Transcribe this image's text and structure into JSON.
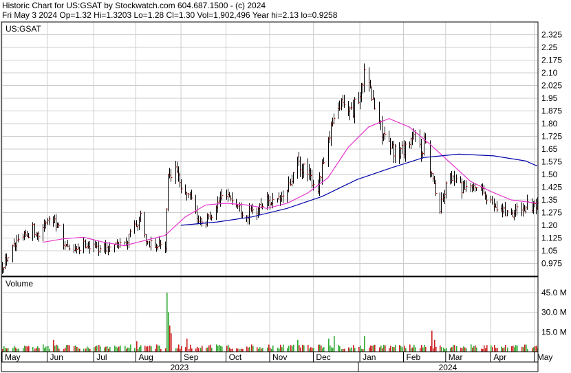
{
  "header": {
    "line1": "Historic Chart for US:GSAT by Stockwatch.com 604.687.1500 - (c) 2024",
    "line2": "Fri May  3 2024   Op=1.32   Hi=1.3203   Lo=1.28   Cl=1.30   Vol=1,902,496   Year hi=2.13   lo=0.9258"
  },
  "colors": {
    "bg": "#ffffff",
    "grid": "#cccccc",
    "frame": "#000000",
    "ma_short": "#e633cc",
    "ma_long": "#0000aa",
    "vol_up": "#33aa33",
    "vol_down": "#cc2222",
    "bar": "#000000",
    "close_tick": "#cc0000"
  },
  "chart_data": [
    {
      "type": "ohlc",
      "title": "US:GSAT",
      "ylim": [
        0.9,
        2.4
      ],
      "y_ticks": [
        0.975,
        1.05,
        1.125,
        1.2,
        1.275,
        1.35,
        1.425,
        1.5,
        1.575,
        1.65,
        1.725,
        1.8,
        1.875,
        1.95,
        2.025,
        2.1,
        2.175,
        2.25,
        2.325
      ],
      "y_tick_labels": [
        "0.975",
        "1.05",
        "1.125",
        "1.20",
        "1.275",
        "1.35",
        "1.425",
        "1.50",
        "1.575",
        "1.65",
        "1.725",
        "1.80",
        "1.875",
        "1.95",
        "2.025",
        "2.10",
        "2.175",
        "2.25",
        "2.325"
      ],
      "grid": true,
      "anchors": [
        [
          "2023-05-01",
          0.96
        ],
        [
          "2023-05-08",
          1.06
        ],
        [
          "2023-05-15",
          1.12
        ],
        [
          "2023-05-22",
          1.18
        ],
        [
          "2023-05-26",
          1.14
        ],
        [
          "2023-06-02",
          1.26
        ],
        [
          "2023-06-06",
          1.24
        ],
        [
          "2023-06-13",
          1.08
        ],
        [
          "2023-06-20",
          1.04
        ],
        [
          "2023-06-27",
          1.09
        ],
        [
          "2023-07-05",
          1.07
        ],
        [
          "2023-07-12",
          1.06
        ],
        [
          "2023-07-19",
          1.08
        ],
        [
          "2023-07-26",
          1.11
        ],
        [
          "2023-08-01",
          1.22
        ],
        [
          "2023-08-04",
          1.25
        ],
        [
          "2023-08-09",
          1.1
        ],
        [
          "2023-08-16",
          1.08
        ],
        [
          "2023-08-21",
          1.07
        ],
        [
          "2023-08-23",
          1.47
        ],
        [
          "2023-08-29",
          1.52
        ],
        [
          "2023-09-01",
          1.44
        ],
        [
          "2023-09-06",
          1.38
        ],
        [
          "2023-09-12",
          1.25
        ],
        [
          "2023-09-18",
          1.22
        ],
        [
          "2023-09-25",
          1.32
        ],
        [
          "2023-10-02",
          1.4
        ],
        [
          "2023-10-09",
          1.32
        ],
        [
          "2023-10-16",
          1.26
        ],
        [
          "2023-10-23",
          1.29
        ],
        [
          "2023-10-30",
          1.35
        ],
        [
          "2023-11-06",
          1.33
        ],
        [
          "2023-11-13",
          1.4
        ],
        [
          "2023-11-20",
          1.57
        ],
        [
          "2023-11-27",
          1.5
        ],
        [
          "2023-12-04",
          1.42
        ],
        [
          "2023-12-11",
          1.67
        ],
        [
          "2023-12-15",
          1.85
        ],
        [
          "2023-12-20",
          1.94
        ],
        [
          "2023-12-28",
          1.88
        ],
        [
          "2024-01-03",
          2.0
        ],
        [
          "2024-01-05",
          2.09
        ],
        [
          "2024-01-10",
          1.96
        ],
        [
          "2024-01-16",
          1.78
        ],
        [
          "2024-01-22",
          1.66
        ],
        [
          "2024-01-29",
          1.63
        ],
        [
          "2024-02-05",
          1.7
        ],
        [
          "2024-02-09",
          1.72
        ],
        [
          "2024-02-13",
          1.64
        ],
        [
          "2024-02-16",
          1.7
        ],
        [
          "2024-02-21",
          1.45
        ],
        [
          "2024-02-26",
          1.3
        ],
        [
          "2024-03-01",
          1.43
        ],
        [
          "2024-03-05",
          1.48
        ],
        [
          "2024-03-12",
          1.42
        ],
        [
          "2024-03-18",
          1.4
        ],
        [
          "2024-03-22",
          1.44
        ],
        [
          "2024-03-28",
          1.36
        ],
        [
          "2024-04-05",
          1.32
        ],
        [
          "2024-04-12",
          1.27
        ],
        [
          "2024-04-18",
          1.28
        ],
        [
          "2024-04-25",
          1.31
        ],
        [
          "2024-05-03",
          1.3
        ]
      ],
      "ma_short": [
        [
          "2023-05-29",
          1.1
        ],
        [
          "2023-06-12",
          1.12
        ],
        [
          "2023-06-26",
          1.13
        ],
        [
          "2023-07-10",
          1.1
        ],
        [
          "2023-07-24",
          1.08
        ],
        [
          "2023-08-07",
          1.11
        ],
        [
          "2023-08-21",
          1.14
        ],
        [
          "2023-09-04",
          1.25
        ],
        [
          "2023-09-18",
          1.32
        ],
        [
          "2023-10-02",
          1.33
        ],
        [
          "2023-10-16",
          1.32
        ],
        [
          "2023-10-30",
          1.3
        ],
        [
          "2023-11-13",
          1.33
        ],
        [
          "2023-11-27",
          1.39
        ],
        [
          "2023-12-11",
          1.48
        ],
        [
          "2023-12-25",
          1.66
        ],
        [
          "2024-01-08",
          1.78
        ],
        [
          "2024-01-22",
          1.83
        ],
        [
          "2024-02-05",
          1.78
        ],
        [
          "2024-02-19",
          1.68
        ],
        [
          "2024-03-04",
          1.57
        ],
        [
          "2024-03-18",
          1.46
        ],
        [
          "2024-04-01",
          1.4
        ],
        [
          "2024-04-15",
          1.35
        ],
        [
          "2024-05-03",
          1.33
        ]
      ],
      "ma_long": [
        [
          "2023-09-01",
          1.2
        ],
        [
          "2023-09-26",
          1.22
        ],
        [
          "2023-10-20",
          1.25
        ],
        [
          "2023-11-13",
          1.3
        ],
        [
          "2023-12-07",
          1.37
        ],
        [
          "2023-12-31",
          1.47
        ],
        [
          "2024-01-24",
          1.54
        ],
        [
          "2024-02-15",
          1.6
        ],
        [
          "2024-03-10",
          1.62
        ],
        [
          "2024-04-03",
          1.61
        ],
        [
          "2024-04-25",
          1.58
        ],
        [
          "2024-05-03",
          1.55
        ]
      ]
    },
    {
      "type": "bar",
      "title": "Volume",
      "ylim": [
        0,
        57
      ],
      "y_ticks": [
        15,
        30,
        45
      ],
      "y_tick_labels": [
        "15.0 M",
        "30.0 M",
        "45.0 M"
      ],
      "base_volume": 4,
      "spikes": [
        [
          "2023-06-05",
          9
        ],
        [
          "2023-08-01",
          8
        ],
        [
          "2023-08-22",
          45
        ],
        [
          "2023-08-23",
          30
        ],
        [
          "2023-08-24",
          20
        ],
        [
          "2023-08-25",
          14
        ],
        [
          "2023-09-05",
          10
        ],
        [
          "2023-11-20",
          9
        ],
        [
          "2023-12-11",
          10
        ],
        [
          "2023-12-15",
          12
        ],
        [
          "2024-01-05",
          12
        ],
        [
          "2024-02-20",
          16
        ],
        [
          "2024-02-22",
          9
        ]
      ]
    }
  ],
  "x_axis": {
    "months": [
      {
        "label": "May",
        "date": "2023-05-01"
      },
      {
        "label": "Jun",
        "date": "2023-06-01"
      },
      {
        "label": "Jul",
        "date": "2023-07-03"
      },
      {
        "label": "Aug",
        "date": "2023-08-01"
      },
      {
        "label": "Sep",
        "date": "2023-09-01"
      },
      {
        "label": "Oct",
        "date": "2023-10-02"
      },
      {
        "label": "Nov",
        "date": "2023-11-01"
      },
      {
        "label": "Dec",
        "date": "2023-12-01"
      },
      {
        "label": "Jan",
        "date": "2024-01-02"
      },
      {
        "label": "Feb",
        "date": "2024-02-01"
      },
      {
        "label": "Mar",
        "date": "2024-03-01"
      },
      {
        "label": "Apr",
        "date": "2024-04-01"
      },
      {
        "label": "May",
        "date": "2024-05-01"
      }
    ],
    "years": [
      {
        "label": "2023",
        "start": "2023-05-01",
        "end": "2023-12-31"
      },
      {
        "label": "2024",
        "start": "2024-01-01",
        "end": "2024-05-03"
      }
    ]
  }
}
